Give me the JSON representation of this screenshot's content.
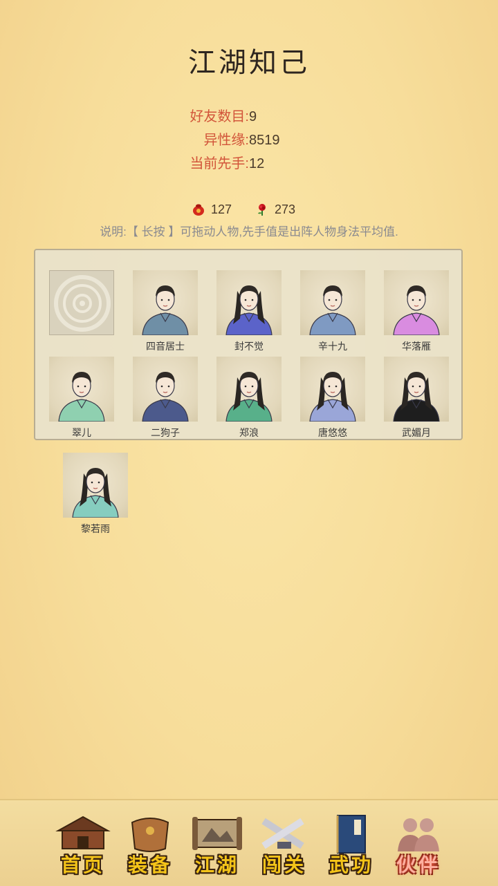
{
  "page": {
    "title": "江湖知己"
  },
  "stats": [
    {
      "label": "好友数目:",
      "value": "9"
    },
    {
      "label": "异性缘:",
      "value": "8519"
    },
    {
      "label": "当前先手:",
      "value": "12"
    }
  ],
  "currency": {
    "pouch": {
      "icon": "red-pouch-icon",
      "value": "127"
    },
    "flower": {
      "icon": "red-rose-icon",
      "value": "273"
    }
  },
  "note": "说明:【 长按 】可拖动人物,先手值是出阵人物身法平均值.",
  "companions": [
    {
      "name": "",
      "icon": "emblem-icon",
      "robe": "#ddd6c4"
    },
    {
      "name": "四音居士",
      "icon": "seated-scholar-portrait",
      "robe": "#6f8fa6"
    },
    {
      "name": "封不觉",
      "icon": "swordsman-portrait",
      "robe": "#5b63c9"
    },
    {
      "name": "辛十九",
      "icon": "warrior-with-staff-portrait",
      "robe": "#7f9ac2"
    },
    {
      "name": "华落雁",
      "icon": "lady-portrait",
      "robe": "#d98ce0"
    },
    {
      "name": "翠儿",
      "icon": "maid-portrait",
      "robe": "#8fd0b0"
    },
    {
      "name": "二狗子",
      "icon": "peasant-portrait",
      "robe": "#4c5a8c"
    },
    {
      "name": "郑浪",
      "icon": "wanderer-portrait",
      "robe": "#58b08a"
    },
    {
      "name": "唐悠悠",
      "icon": "maiden-portrait",
      "robe": "#9aa6d8"
    },
    {
      "name": "武媚月",
      "icon": "flute-player-portrait",
      "robe": "#1e1e1e"
    }
  ],
  "extra_companion": {
    "name": "黎若雨",
    "icon": "girl-portrait",
    "robe": "#86cdbf"
  },
  "nav": [
    {
      "label": "首页",
      "icon": "house-icon",
      "active": false
    },
    {
      "label": "装备",
      "icon": "armor-icon",
      "active": false
    },
    {
      "label": "江湖",
      "icon": "scroll-map-icon",
      "active": false
    },
    {
      "label": "闯关",
      "icon": "crossed-swords-icon",
      "active": false
    },
    {
      "label": "武功",
      "icon": "book-icon",
      "active": false
    },
    {
      "label": "伙伴",
      "icon": "companions-icon",
      "active": true
    }
  ]
}
